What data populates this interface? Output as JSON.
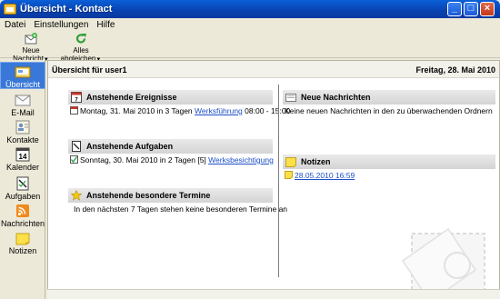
{
  "window": {
    "title": "Übersicht - Kontact"
  },
  "menu": [
    "Datei",
    "Einstellungen",
    "Hilfe"
  ],
  "toolbar": {
    "new_message": "Neue Nachricht",
    "sync_all": "Alles abgleichen"
  },
  "sidebar": {
    "items": [
      {
        "label": "Übersicht",
        "icon": "overview-icon",
        "active": true
      },
      {
        "label": "E-Mail",
        "icon": "envelope-icon"
      },
      {
        "label": "Kontakte",
        "icon": "contacts-icon"
      },
      {
        "label": "Kalender",
        "icon": "calendar-icon",
        "badge": "14"
      },
      {
        "label": "Aufgaben",
        "icon": "tasks-icon"
      },
      {
        "label": "Nachrichten",
        "icon": "rss-icon"
      },
      {
        "label": "Notizen",
        "icon": "notes-icon"
      }
    ]
  },
  "main": {
    "title": "Übersicht für user1",
    "date": "Freitag, 28. Mai 2010",
    "events": {
      "heading": "Anstehende Ereignisse",
      "item_prefix": "Montag, 31. Mai 2010 in 3 Tagen",
      "item_link": "Werksführung",
      "item_time": "08:00 - 15:00"
    },
    "tasks": {
      "heading": "Anstehende Aufgaben",
      "item_prefix": "Sonntag, 30. Mai 2010 in 2 Tagen",
      "item_priority": "[5]",
      "item_link": "Werksbesichtigung"
    },
    "special": {
      "heading": "Anstehende besondere Termine",
      "text": "In den nächsten 7 Tagen stehen keine besonderen Termine an"
    },
    "news": {
      "heading": "Neue Nachrichten",
      "text": "Keine neuen Nachrichten in den zu überwachenden Ordnern"
    },
    "notes": {
      "heading": "Notizen",
      "item_link": "28.05.2010 16:59"
    }
  },
  "colors": {
    "titlebar": "#0842b0",
    "active_nav": "#3978d8",
    "link": "#1d4fc6"
  }
}
